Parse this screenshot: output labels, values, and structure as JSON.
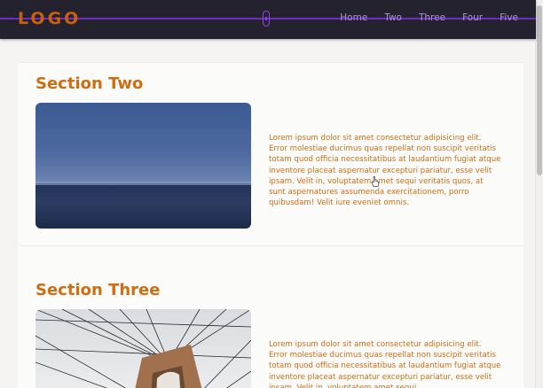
{
  "navbar": {
    "logo": "LOGO",
    "links": [
      "Home",
      "Two",
      "Three",
      "Four",
      "Five"
    ],
    "colors": {
      "background": "#23222e",
      "logo": "#c9600d",
      "links": "#b78fd6",
      "progress": "#6a2fbf"
    }
  },
  "sections": [
    {
      "title": "Section Two",
      "image": "ocean-horizon-image",
      "text": "Lorem ipsum dolor sit amet consectetur adipisicing elit. Error molestiae ducimus quas repellat non suscipit veritatis totam quod officia necessitatibus at laudantium fugiat atque inventore placeat aspernatur excepturi pariatur, esse velit ipsam. Velit in, voluptatem amet sequi veritatis quos, at sunt aspernatures assumenda exercitationem, porro quibusdam! Velit iure eveniet omnis."
    },
    {
      "title": "Section Three",
      "image": "bridge-cables-image",
      "text": "Lorem ipsum dolor sit amet consectetur adipisicing elit. Error molestiae ducimus quas repellat non suscipit veritatis totam quod officia necessitatibus at laudantium fugiat atque inventore placeat aspernatur excepturi pariatur, esse velit ipsam. Velit in, voluptatem amet sequi"
    }
  ],
  "colors": {
    "accent": "#cc6e12",
    "page": "#f5f4f2"
  }
}
